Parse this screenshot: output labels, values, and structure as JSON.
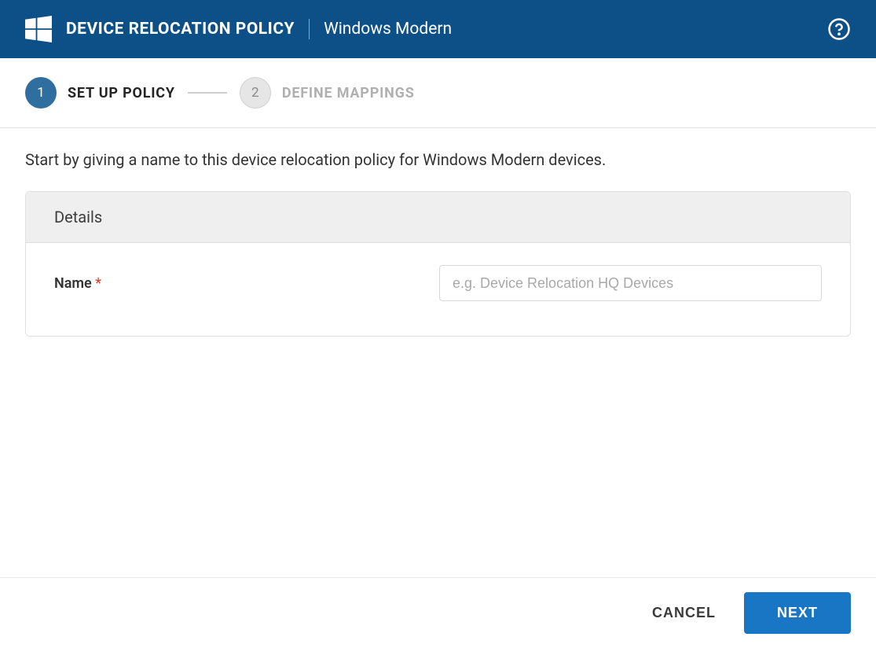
{
  "header": {
    "title": "DEVICE RELOCATION POLICY",
    "subtitle": "Windows Modern"
  },
  "stepper": {
    "steps": [
      {
        "number": "1",
        "label": "SET UP POLICY",
        "active": true
      },
      {
        "number": "2",
        "label": "DEFINE MAPPINGS",
        "active": false
      }
    ]
  },
  "content": {
    "intro": "Start by giving a name to this device relocation policy for Windows Modern devices.",
    "card_title": "Details",
    "name_label": "Name",
    "name_required": "*",
    "name_placeholder": "e.g. Device Relocation HQ Devices",
    "name_value": ""
  },
  "footer": {
    "cancel": "CANCEL",
    "next": "NEXT"
  }
}
